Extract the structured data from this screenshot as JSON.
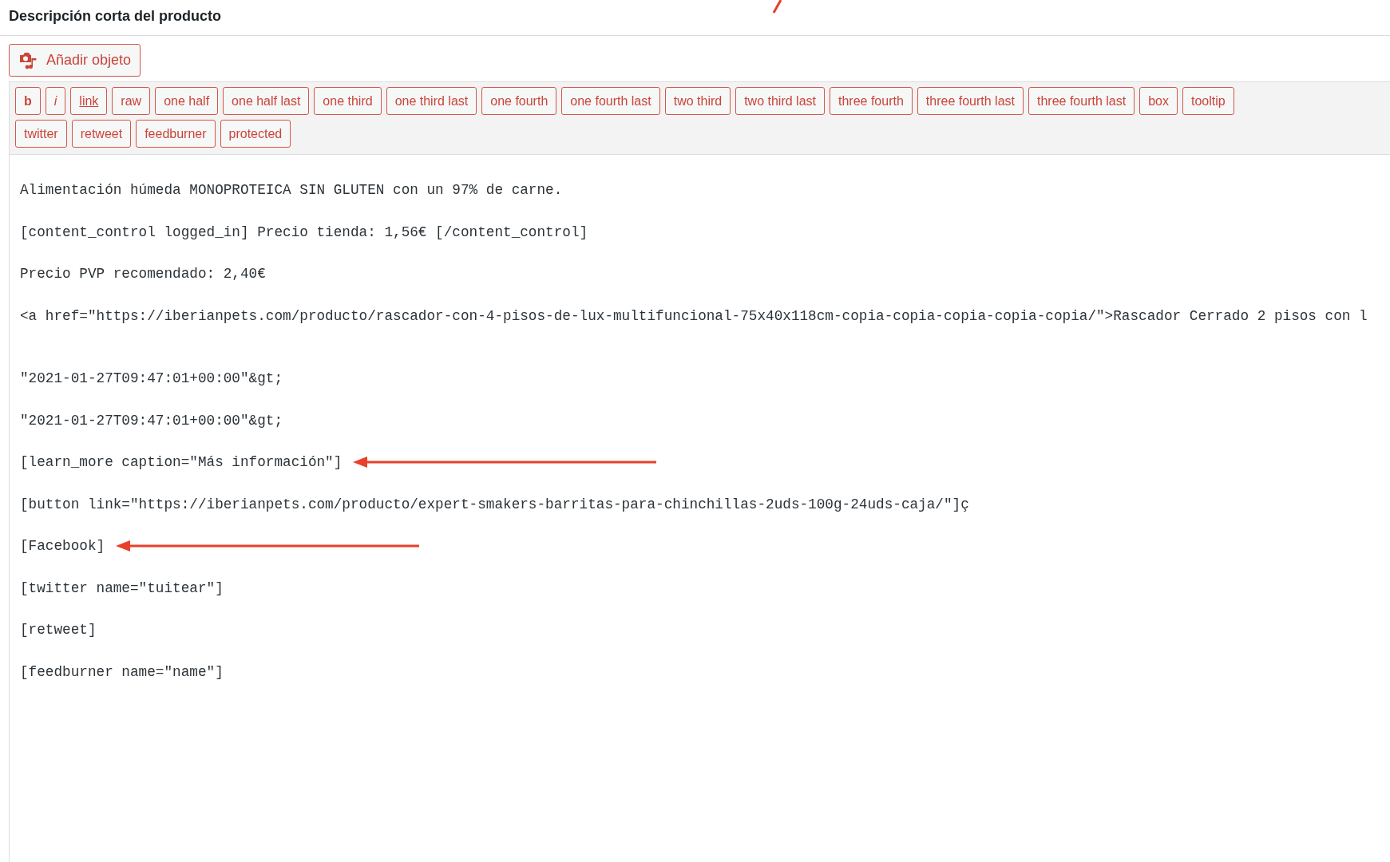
{
  "section": {
    "title": "Descripción corta del producto"
  },
  "add_object_button": {
    "label": "Añadir objeto"
  },
  "quicktag_rows": [
    [
      {
        "label": "b",
        "kind": "bold"
      },
      {
        "label": "i",
        "kind": "italic"
      },
      {
        "label": "link",
        "kind": "underline"
      },
      {
        "label": "raw",
        "kind": "plain"
      },
      {
        "label": "one half",
        "kind": "plain"
      },
      {
        "label": "one half last",
        "kind": "plain"
      },
      {
        "label": "one third",
        "kind": "plain"
      },
      {
        "label": "one third last",
        "kind": "plain"
      },
      {
        "label": "one fourth",
        "kind": "plain"
      },
      {
        "label": "one fourth last",
        "kind": "plain"
      },
      {
        "label": "two third",
        "kind": "plain"
      },
      {
        "label": "two third last",
        "kind": "plain"
      },
      {
        "label": "three fourth",
        "kind": "plain"
      },
      {
        "label": "three fourth last",
        "kind": "plain"
      },
      {
        "label": "three fourth last",
        "kind": "plain"
      },
      {
        "label": "box",
        "kind": "plain"
      },
      {
        "label": "tooltip",
        "kind": "plain"
      }
    ],
    [
      {
        "label": "twitter",
        "kind": "plain"
      },
      {
        "label": "retweet",
        "kind": "plain"
      },
      {
        "label": "feedburner",
        "kind": "plain"
      },
      {
        "label": "protected",
        "kind": "plain"
      }
    ]
  ],
  "editor": {
    "lines": [
      {
        "kind": "text",
        "text": "Alimentación húmeda MONOPROTEICA SIN GLUTEN con un 97% de carne."
      },
      {
        "kind": "text",
        "text": "[content_control logged_in] Precio tienda: 1,56€ [/content_control]"
      },
      {
        "kind": "text",
        "text": "Precio PVP recomendado: 2,40€"
      },
      {
        "kind": "text",
        "text": "<a href=\"https://iberianpets.com/producto/rascador-con-4-pisos-de-lux-multifuncional-75x40x118cm-copia-copia-copia-copia-copia/\">Rascador Cerrado 2 pisos con l"
      },
      {
        "kind": "blank"
      },
      {
        "kind": "text",
        "text": "\"2021-01-27T09:47:01+00:00\"&gt;"
      },
      {
        "kind": "text",
        "text": "\"2021-01-27T09:47:01+00:00\"&gt;"
      },
      {
        "kind": "annotated",
        "text": "[learn_more caption=\"Más información\"]"
      },
      {
        "kind": "text",
        "text": "[button link=\"https://iberianpets.com/producto/expert-smakers-barritas-para-chinchillas-2uds-100g-24uds-caja/\"]ç"
      },
      {
        "kind": "annotated",
        "text": "[Facebook]"
      },
      {
        "kind": "text",
        "text": "[twitter name=\"tuitear\"]"
      },
      {
        "kind": "text",
        "text": "[retweet]"
      },
      {
        "kind": "text",
        "text": "[feedburner name=\"name\"]"
      }
    ]
  }
}
